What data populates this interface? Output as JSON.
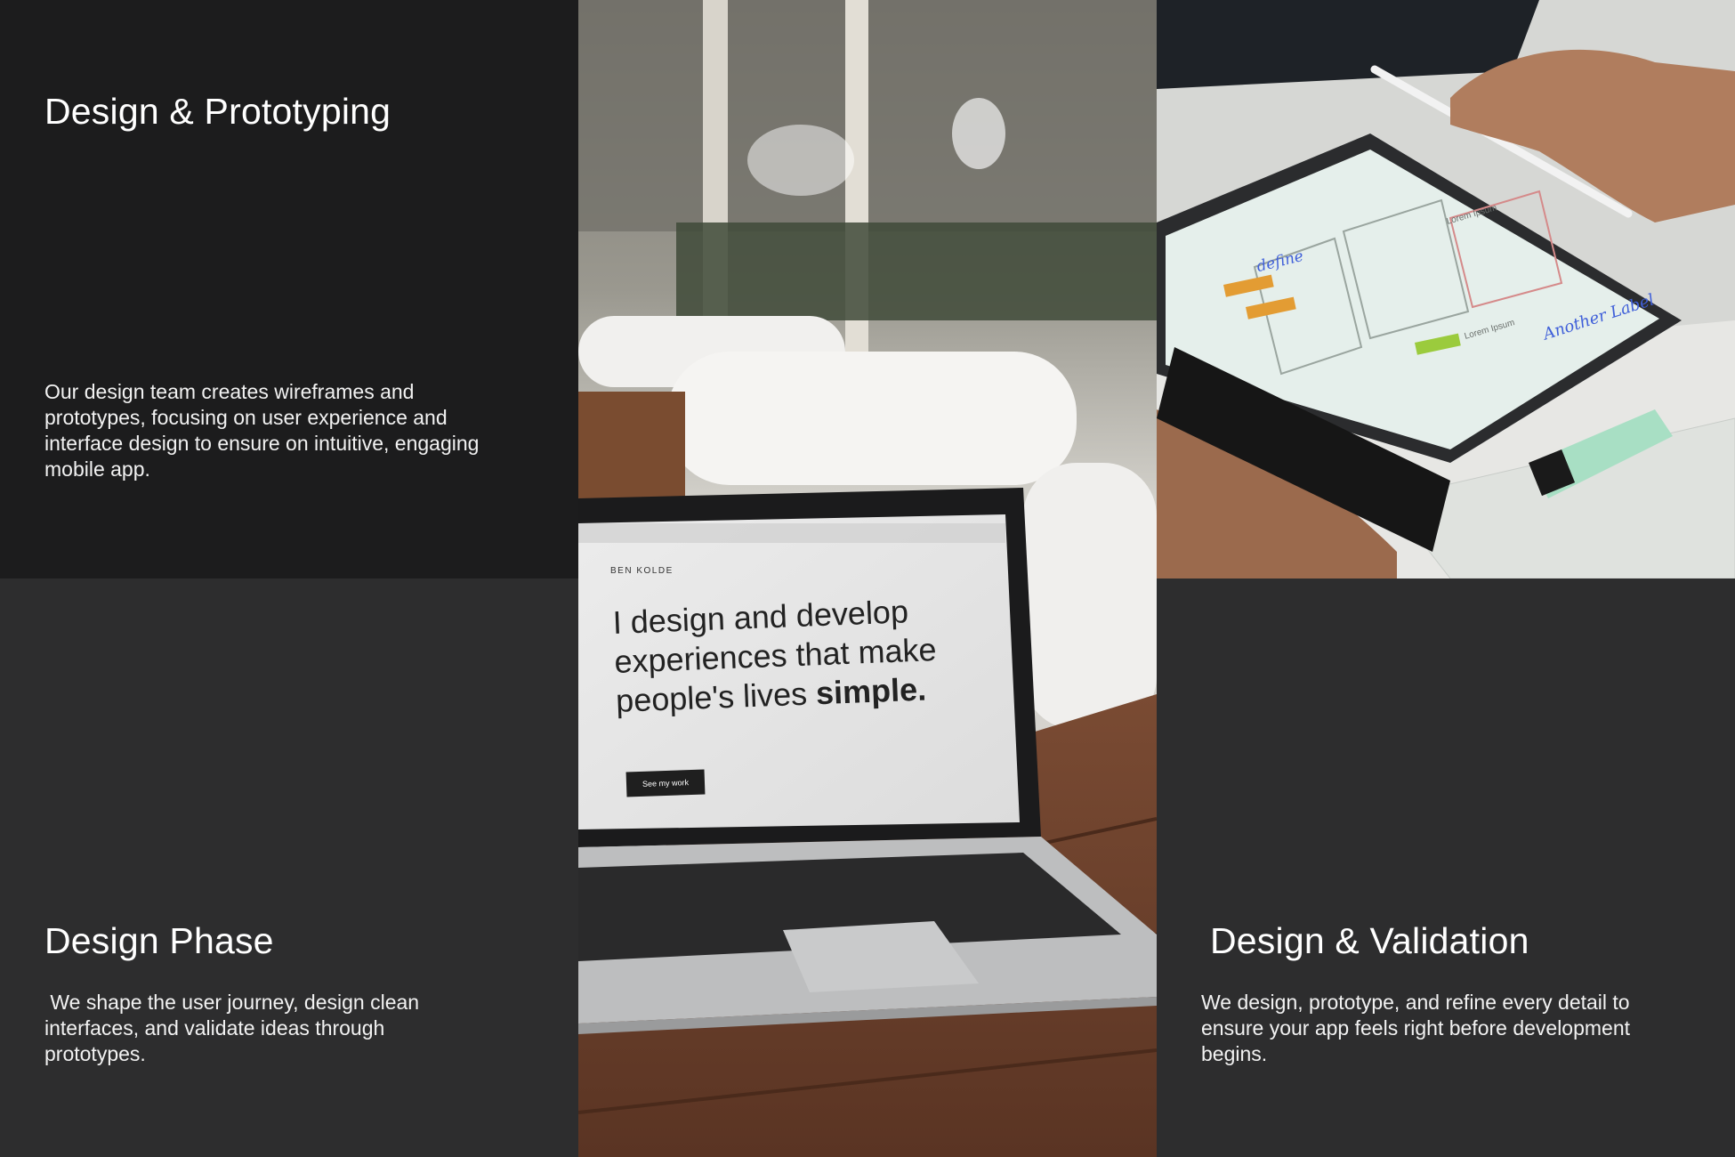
{
  "cards": {
    "top_left": {
      "title": "Design & Prototyping",
      "description": "Our design team creates wireframes and prototypes, focusing on user experience and interface design to ensure on intuitive, engaging mobile app."
    },
    "bottom_left": {
      "title": "Design Phase",
      "description": " We shape the user journey, design clean interfaces, and validate ideas through prototypes."
    },
    "bottom_right": {
      "title": "Design & Validation",
      "description": "We design, prototype, and refine every detail to ensure your app feels right before development begins."
    }
  },
  "photo_center": {
    "alt": "laptop-on-wooden-table-photo",
    "screen_brand": "BEN KOLDE",
    "screen_line1": "I design and develop",
    "screen_line2": "experiences that make",
    "screen_line3_regular": "people's lives ",
    "screen_line3_bold": "simple.",
    "screen_button": "See my work"
  },
  "photo_top_right": {
    "alt": "hands-drawing-wireframe-on-tablet-photo",
    "note_define": "define",
    "note_another": "Another Label",
    "note_lorem1": "Lorem Ipsum",
    "note_lorem2": "Lorem Ipsum"
  },
  "colors": {
    "card_dark": "#1c1c1d",
    "card_mid": "#2d2d2e",
    "text": "#ffffff"
  }
}
